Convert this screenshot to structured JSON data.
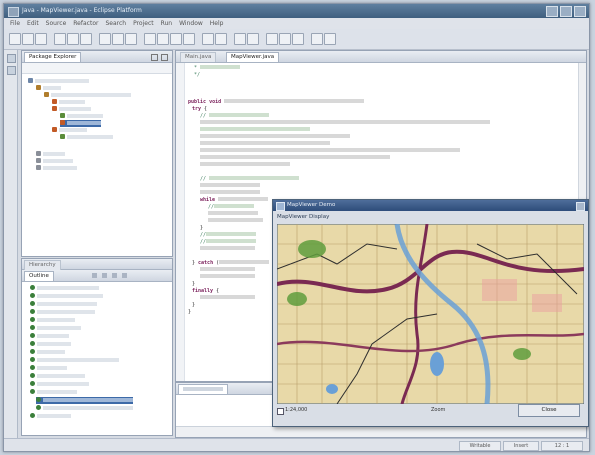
{
  "window": {
    "title": "Java - MapViewer.java - Eclipse Platform",
    "controls": [
      "minimize",
      "maximize",
      "close"
    ]
  },
  "menu": [
    "File",
    "Edit",
    "Source",
    "Refactor",
    "Search",
    "Project",
    "Run",
    "Window",
    "Help"
  ],
  "views": {
    "package_explorer_tab": "Package Explorer",
    "hierarchy_tab": "Hierarchy",
    "outline_tab": "Outline"
  },
  "editor": {
    "tabs": [
      "Main.java",
      "MapViewer.java"
    ]
  },
  "map_window": {
    "title": "MapViewer Demo",
    "header": "MapViewer Display",
    "status_text": "1:24,000",
    "zoom_text": "Zoom",
    "button_label": "Close"
  },
  "status": {
    "cells": [
      "Writable",
      "Insert",
      "12 : 1"
    ]
  },
  "colors": {
    "keyword": "#7a1f5a",
    "comment": "#3f7f5f",
    "titlebar": "#3f5f7f",
    "map_road": "#7a2a52",
    "map_water": "#6aa0d6",
    "map_park": "#5f9c3d"
  }
}
